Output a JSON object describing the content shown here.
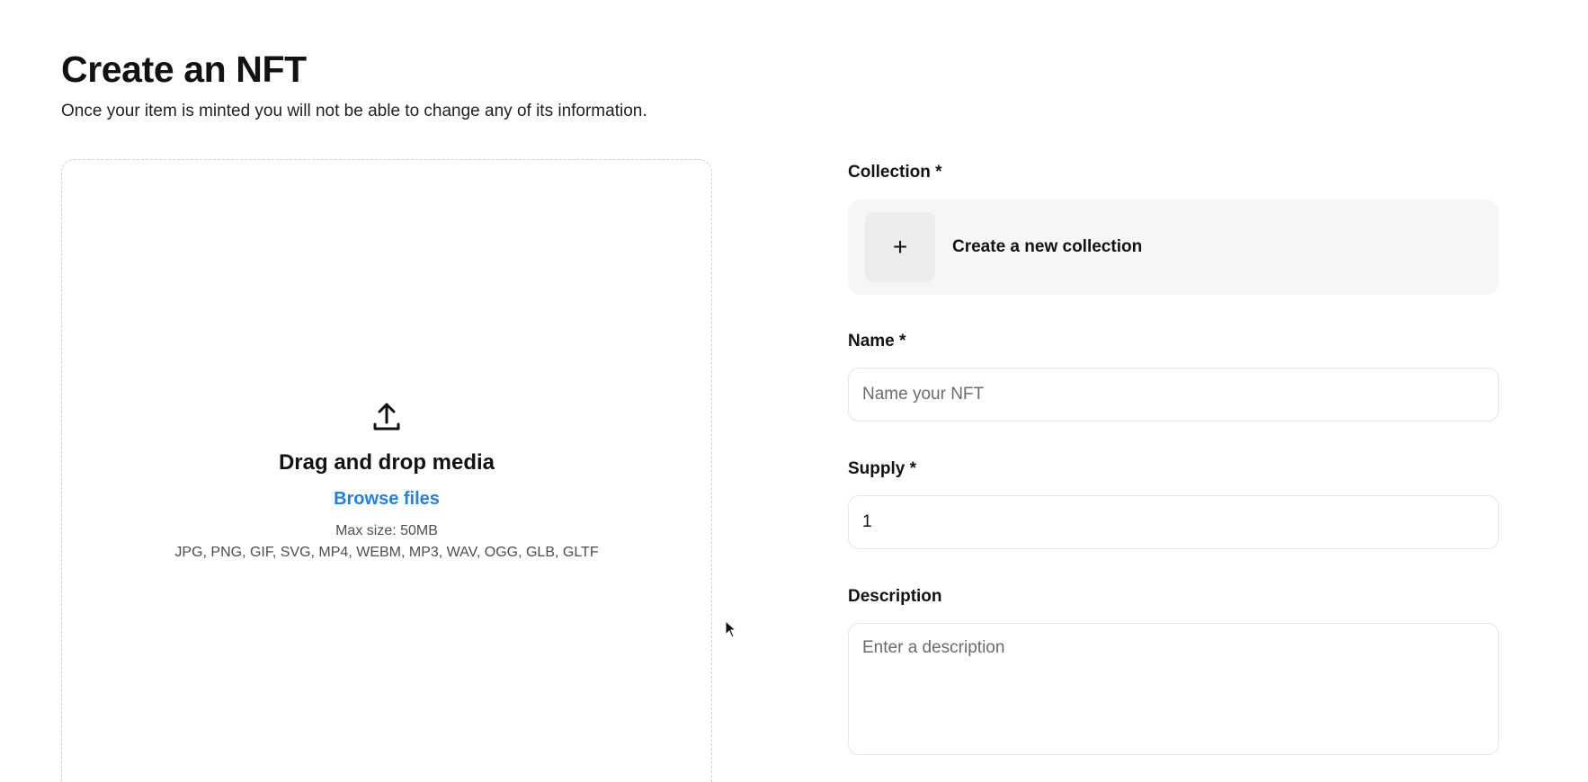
{
  "header": {
    "title": "Create an NFT",
    "subtitle": "Once your item is minted you will not be able to change any of its information."
  },
  "dropzone": {
    "icon": "upload-icon",
    "heading": "Drag and drop media",
    "browse_label": "Browse files",
    "max_size": "Max size: 50MB",
    "file_types": "JPG, PNG, GIF, SVG, MP4, WEBM, MP3, WAV, OGG, GLB, GLTF"
  },
  "form": {
    "collection": {
      "label": "Collection *",
      "create_label": "Create a new collection",
      "icon": "plus-icon",
      "icon_glyph": "+"
    },
    "name": {
      "label": "Name *",
      "placeholder": "Name your NFT",
      "value": ""
    },
    "supply": {
      "label": "Supply *",
      "value": "1"
    },
    "description": {
      "label": "Description",
      "placeholder": "Enter a description"
    }
  },
  "colors": {
    "accent": "#2081e2",
    "text": "#121212",
    "card_bg": "#f6f6f6",
    "border": "#e5e5e5"
  }
}
